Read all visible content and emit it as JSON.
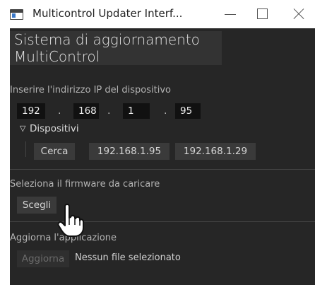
{
  "window": {
    "title": "Multicontrol Updater Interf...",
    "icon": "app-window-icon"
  },
  "header": {
    "line1": "Sistema di aggiornamento",
    "line2": "MultiControl"
  },
  "ip_section": {
    "label": "Inserire l'indirizzo IP del dispositivo",
    "octets": [
      "192",
      "168",
      "1",
      "95"
    ],
    "separator": "."
  },
  "devices": {
    "toggle_label": "Dispositivi",
    "search_label": "Cerca",
    "found": [
      "192.168.1.95",
      "192.168.1.29"
    ]
  },
  "firmware": {
    "label": "Seleziona il firmware da caricare",
    "choose_label": "Scegli"
  },
  "update": {
    "label": "Aggiorna l'applicazione",
    "button_label": "Aggiorna",
    "status": "Nessun file selezionato"
  },
  "colors": {
    "background": "#262626",
    "header_band": "#333333",
    "button": "#3a3a3a",
    "input": "#111111"
  }
}
